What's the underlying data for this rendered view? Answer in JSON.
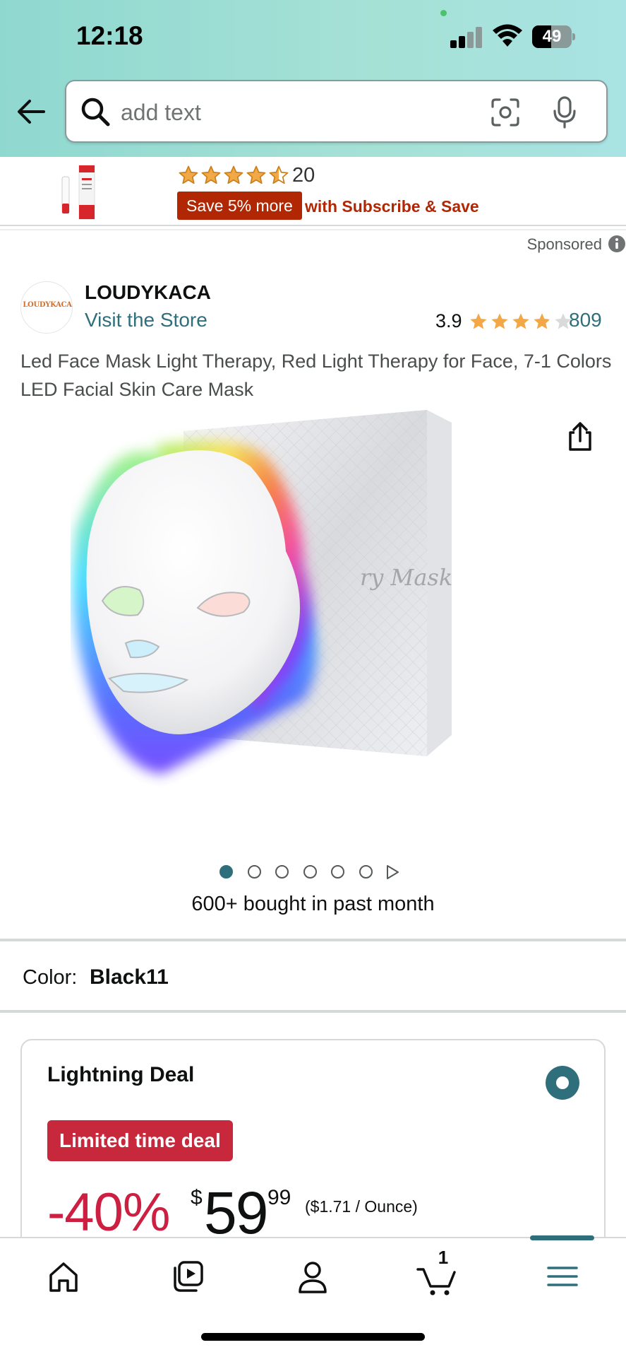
{
  "status_bar": {
    "time": "12:18",
    "battery": "49",
    "battery_level": 0.49
  },
  "search": {
    "placeholder": "add text",
    "icons": [
      "back-arrow-icon",
      "search-icon",
      "camera-scan-icon",
      "mic-icon"
    ]
  },
  "promo": {
    "rating": 4.5,
    "review_count": "20",
    "badge": "Save 5% more",
    "subscribe_text": "with Subscribe & Save"
  },
  "sponsored_label": "Sponsored",
  "brand": {
    "logo_text": "LOUDYKACA",
    "name": "LOUDYKACA",
    "visit_store": "Visit the Store"
  },
  "rating": {
    "value": "3.9",
    "stars": 3.9,
    "count": "809"
  },
  "product": {
    "title": "Led Face Mask Light Therapy, Red Light Therapy for Face, 7-1 Colors LED Facial Skin Care Mask",
    "box_text": "ry Mask",
    "image_count": 6,
    "active_image": 0,
    "bought_text": "600+ bought in past month"
  },
  "color": {
    "label": "Color:",
    "value": "Black11"
  },
  "deal": {
    "title": "Lightning Deal",
    "badge": "Limited time deal",
    "discount": "-40%",
    "currency": "$",
    "price_whole": "59",
    "price_fraction": "99",
    "unit_price": "($1.71 / Ounce)"
  },
  "nav": {
    "items": [
      "home-icon",
      "video-icon",
      "account-icon",
      "cart-icon",
      "menu-icon"
    ],
    "cart_count": "1"
  },
  "colors": {
    "accent": "#2f6f7c",
    "deal_red": "#cc1f42",
    "star": "#f3a847",
    "header": "#a6e1d6"
  }
}
